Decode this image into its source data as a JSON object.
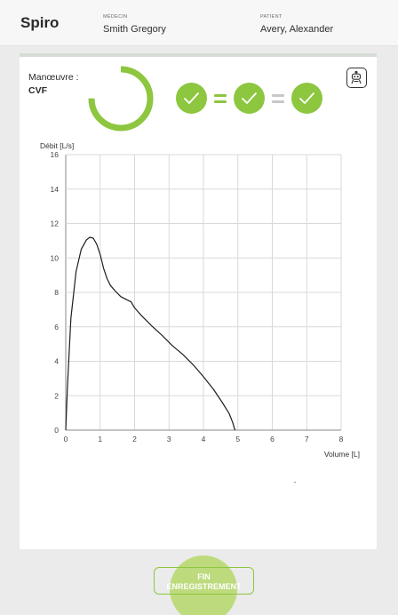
{
  "header": {
    "app_title": "Spiro",
    "doctor_label": "MÉDECIN",
    "doctor_name": "Smith Gregory",
    "patient_label": "PATIENT",
    "patient_name": "Avery, Alexander"
  },
  "maneuver": {
    "label": "Manœuvre :",
    "value": "CVF",
    "progress_fraction": 0.75
  },
  "checks": {
    "count": 3,
    "symbols": [
      "=",
      "="
    ],
    "icon": "checkmark-icon",
    "robot_icon": "robot-icon"
  },
  "colors": {
    "accent": "#8dc63f",
    "accent_light": "#b5d86a",
    "inactive": "#c8c8c8"
  },
  "chart_data": {
    "type": "line",
    "title": "",
    "ylabel": "Débit [L/s]",
    "xlabel": "Volume [L]",
    "xlim": [
      0,
      8
    ],
    "ylim": [
      0,
      16
    ],
    "x_ticks": [
      "0",
      "1",
      "2",
      "3",
      "4",
      "5",
      "6",
      "7",
      "8"
    ],
    "y_ticks": [
      "0",
      "2",
      "4",
      "6",
      "8",
      "10",
      "12",
      "14",
      "16"
    ],
    "grid": true,
    "series": [
      {
        "points": [
          [
            0,
            0
          ],
          [
            0.05,
            2.5
          ],
          [
            0.15,
            6.5
          ],
          [
            0.3,
            9.2
          ],
          [
            0.45,
            10.5
          ],
          [
            0.6,
            11.05
          ],
          [
            0.7,
            11.2
          ],
          [
            0.8,
            11.15
          ],
          [
            0.9,
            10.8
          ],
          [
            1,
            10.2
          ],
          [
            1.1,
            9.4
          ],
          [
            1.2,
            8.8
          ],
          [
            1.3,
            8.4
          ],
          [
            1.45,
            8.05
          ],
          [
            1.6,
            7.75
          ],
          [
            1.75,
            7.6
          ],
          [
            1.9,
            7.45
          ],
          [
            2,
            7.1
          ],
          [
            2.2,
            6.65
          ],
          [
            2.5,
            6.05
          ],
          [
            2.8,
            5.5
          ],
          [
            3.1,
            4.9
          ],
          [
            3.4,
            4.4
          ],
          [
            3.7,
            3.8
          ],
          [
            4,
            3.1
          ],
          [
            4.3,
            2.35
          ],
          [
            4.55,
            1.6
          ],
          [
            4.75,
            0.95
          ],
          [
            4.85,
            0.45
          ],
          [
            4.9,
            0.1
          ],
          [
            4.92,
            0
          ]
        ]
      }
    ]
  },
  "finish_button": {
    "line1": "FIN",
    "line2": "ENREGISTREMENT"
  }
}
